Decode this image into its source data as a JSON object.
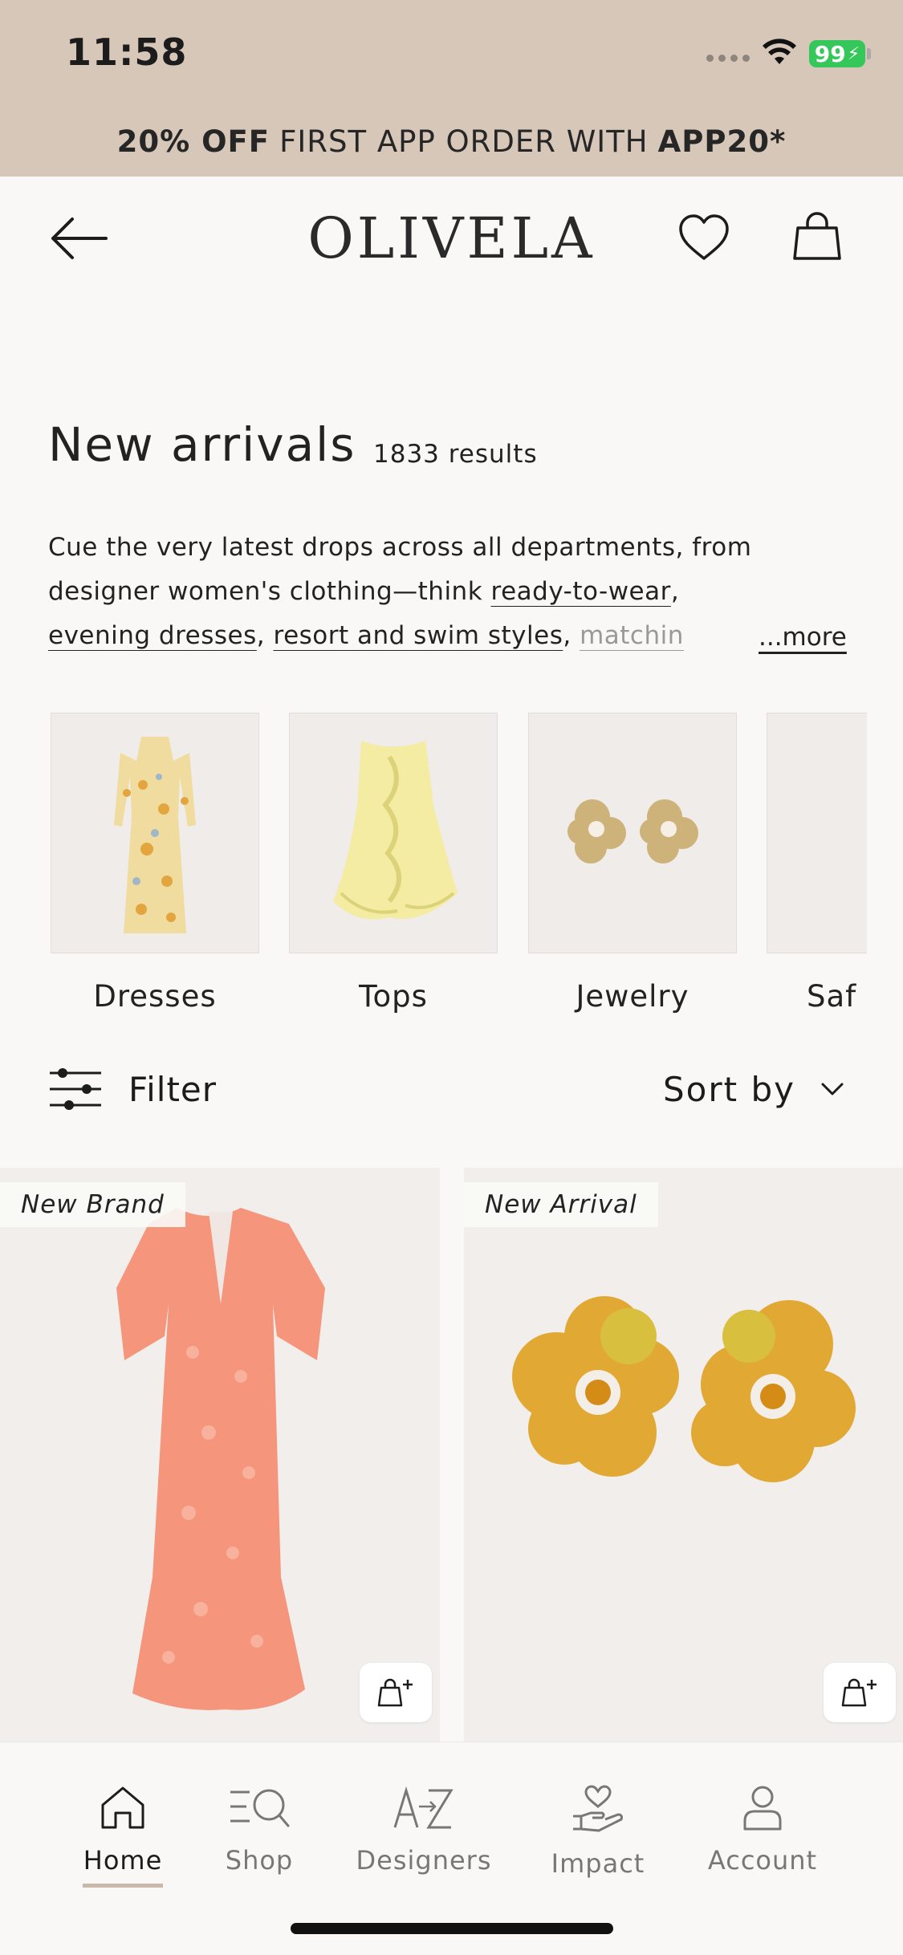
{
  "status_bar": {
    "time": "11:58",
    "battery": "99"
  },
  "promo": {
    "bold1": "20% OFF",
    "middle": "FIRST APP ORDER WITH",
    "bold2": "APP20*"
  },
  "header": {
    "logo": "OLIVELA"
  },
  "page": {
    "title": "New arrivals",
    "results": "1833 results",
    "description": {
      "line1": "Cue the very latest drops across all departments, from",
      "line2_prefix": "designer women's clothing—think ",
      "link_ready": "ready-to-wear",
      "line2_suffix": ",",
      "link_evening": "evening dresses",
      "sep1": ", ",
      "link_resort": "resort and swim styles",
      "sep2": ", ",
      "link_matching": "matchin",
      "more": "...more"
    }
  },
  "categories": [
    {
      "label": "Dresses"
    },
    {
      "label": "Tops"
    },
    {
      "label": "Jewelry"
    },
    {
      "label": "Saf"
    }
  ],
  "filter": {
    "label": "Filter"
  },
  "sort": {
    "label": "Sort by"
  },
  "products": [
    {
      "badge": "New Brand"
    },
    {
      "badge": "New Arrival"
    }
  ],
  "nav": {
    "home": "Home",
    "shop": "Shop",
    "designers": "Designers",
    "impact": "Impact",
    "account": "Account"
  },
  "colors": {
    "status_bg": "#d6c7b9",
    "page_bg": "#f9f8f6",
    "battery": "#35c759",
    "nav_underline": "#c9b9ab"
  }
}
